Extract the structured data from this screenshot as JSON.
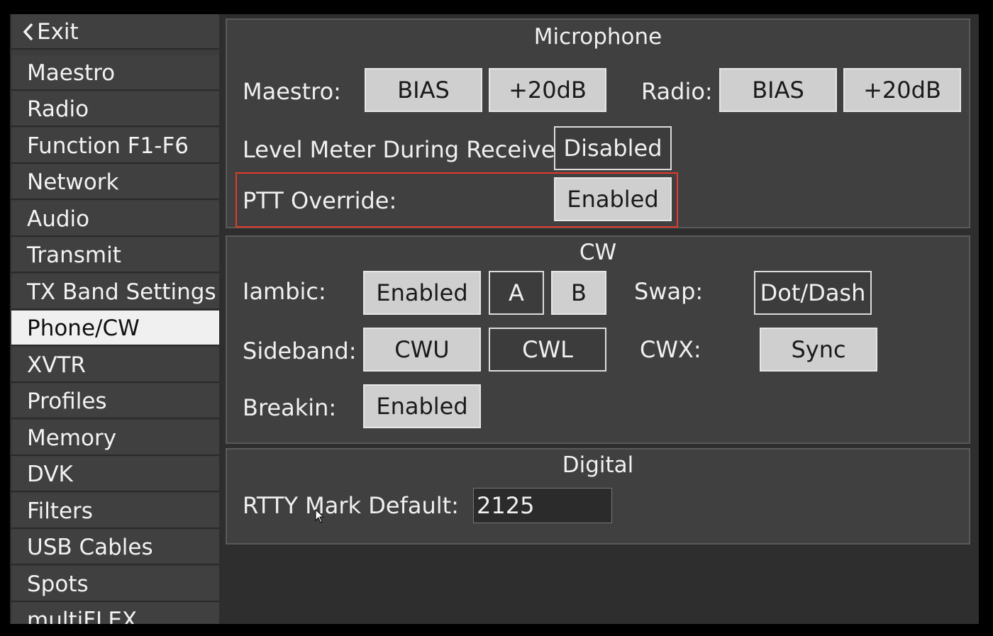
{
  "sidebar": {
    "exit_label": "Exit",
    "items": [
      {
        "label": "Maestro"
      },
      {
        "label": "Radio"
      },
      {
        "label": "Function F1-F6"
      },
      {
        "label": "Network"
      },
      {
        "label": "Audio"
      },
      {
        "label": "Transmit"
      },
      {
        "label": "TX Band Settings"
      },
      {
        "label": "Phone/CW",
        "active": true
      },
      {
        "label": "XVTR"
      },
      {
        "label": "Profiles"
      },
      {
        "label": "Memory"
      },
      {
        "label": "DVK"
      },
      {
        "label": "Filters"
      },
      {
        "label": "USB Cables"
      },
      {
        "label": "Spots"
      },
      {
        "label": "multiFLEX"
      }
    ]
  },
  "microphone": {
    "title": "Microphone",
    "maestro_label": "Maestro:",
    "maestro_bias": "BIAS",
    "maestro_boost": "+20dB",
    "radio_label": "Radio:",
    "radio_bias": "BIAS",
    "radio_boost": "+20dB",
    "level_meter_label": "Level Meter During Receive:",
    "level_meter_value": "Disabled",
    "ptt_override_label": "PTT Override:",
    "ptt_override_value": "Enabled"
  },
  "cw": {
    "title": "CW",
    "iambic_label": "Iambic:",
    "iambic_value": "Enabled",
    "mode_a": "A",
    "mode_b": "B",
    "swap_label": "Swap:",
    "swap_value": "Dot/Dash",
    "sideband_label": "Sideband:",
    "sideband_cwu": "CWU",
    "sideband_cwl": "CWL",
    "cwx_label": "CWX:",
    "cwx_value": "Sync",
    "breakin_label": "Breakin:",
    "breakin_value": "Enabled"
  },
  "digital": {
    "title": "Digital",
    "rtty_label": "RTTY Mark Default:",
    "rtty_value": "2125"
  },
  "colors": {
    "highlight": "#e03a2c",
    "active_button": "#cfcfcf",
    "panel": "#404040"
  }
}
